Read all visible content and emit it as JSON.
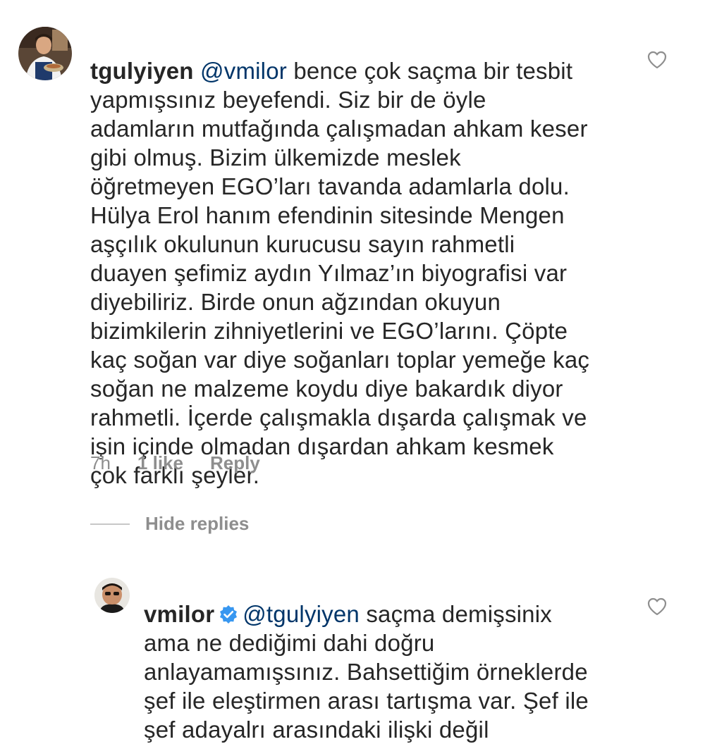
{
  "comments": [
    {
      "username": "tgulyiyen",
      "mention": "@vmilor",
      "text": " bence çok saçma bir tesbit\nyapmışsınız beyefendi. Siz bir de öyle\nadamların mutfağında çalışmadan ahkam keser\ngibi olmuş. Bizim ülkemizde meslek\nöğretmeyen EGO’ları tavanda adamlarla dolu.\nHülya Erol hanım efendinin sitesinde Mengen\naşçılık okulunun kurucusu sayın rahmetli\nduayen şefimiz aydın Yılmaz’ın biyografisi  var\ndiyebiliriz. Birde onun ağzından okuyun\nbizimkilerin zihniyetlerini ve EGO’larını. Çöpte\nkaç soğan var diye soğanları toplar yemeğe kaç\nsoğan ne malzeme koydu diye bakardık diyor\nrahmetli. İçerde çalışmakla dışarda çalışmak ve\nişin içinde olmadan dışardan ahkam kesmek\nçok farklı şeyler.",
      "time": "7h",
      "likes": "1 like",
      "reply_label": "Reply",
      "avatar_icon": "chef-avatar",
      "like_icon": "heart-outline-icon"
    },
    {
      "username": "vmilor",
      "verified": true,
      "verified_icon": "verified-badge-icon",
      "mention": "@tgulyiyen",
      "text": " saçma demişsinix\nama ne dediğimi dahi doğru\nanlayamamışsınız. Bahsettiğim örneklerde\nşef ile eleştirmen arası tartışma var. Şef ile\nşef adayalrı arasındaki ilişki değil",
      "avatar_icon": "user-avatar",
      "like_icon": "heart-outline-icon"
    }
  ],
  "hide_replies_label": "Hide replies",
  "colors": {
    "text": "#262626",
    "mention": "#003569",
    "meta": "#8e8e8e",
    "verified": "#3897f0",
    "divider": "#c7c7c7"
  }
}
